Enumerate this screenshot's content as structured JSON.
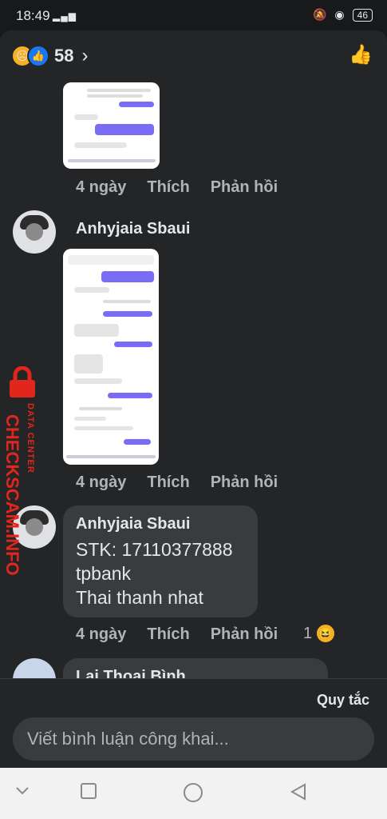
{
  "status": {
    "time": "18:49",
    "battery": "46",
    "signal": "▂▄▆"
  },
  "header": {
    "reaction_count": "58"
  },
  "comments": [
    {
      "time": "4 ngày",
      "like": "Thích",
      "reply": "Phản hồi"
    },
    {
      "author": "Anhyjaia Sbaui",
      "time": "4 ngày",
      "like": "Thích",
      "reply": "Phản hồi"
    },
    {
      "author": "Anhyjaia Sbaui",
      "lines": [
        "STK: 17110377888",
        "tpbank",
        "Thai thanh nhat"
      ],
      "time": "4 ngày",
      "like": "Thích",
      "reply": "Phản hồi",
      "reaction_count": "1"
    },
    {
      "author": "Lai Thoai Bình"
    }
  ],
  "watermark": {
    "big": "CHECKSCAM.INFO",
    "small": "DATA CENTER"
  },
  "footer": {
    "rules": "Quy tắc",
    "placeholder": "Viết bình luận công khai..."
  }
}
